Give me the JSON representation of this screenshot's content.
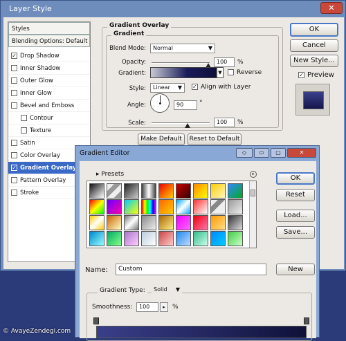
{
  "layer_style": {
    "title": "Layer Style",
    "close_glyph": "✕",
    "list": [
      {
        "label": "Styles",
        "type": "header"
      },
      {
        "label": "Blending Options: Default",
        "type": "header"
      },
      {
        "label": "Drop Shadow",
        "checked": true
      },
      {
        "label": "Inner Shadow",
        "checked": false
      },
      {
        "label": "Outer Glow",
        "checked": false
      },
      {
        "label": "Inner Glow",
        "checked": false
      },
      {
        "label": "Bevel and Emboss",
        "checked": false
      },
      {
        "label": "Contour",
        "checked": false,
        "indent": true
      },
      {
        "label": "Texture",
        "checked": false,
        "indent": true
      },
      {
        "label": "Satin",
        "checked": false
      },
      {
        "label": "Color Overlay",
        "checked": false
      },
      {
        "label": "Gradient Overlay",
        "checked": true,
        "selected": true
      },
      {
        "label": "Pattern Overlay",
        "checked": false
      },
      {
        "label": "Stroke",
        "checked": false
      }
    ],
    "panel": {
      "group_title": "Gradient Overlay",
      "sub_title": "Gradient",
      "blend_mode_label": "Blend Mode:",
      "blend_mode_value": "Normal",
      "opacity_label": "Opacity:",
      "opacity_value": "100",
      "opacity_unit": "%",
      "gradient_label": "Gradient:",
      "reverse_label": "Reverse",
      "style_label": "Style:",
      "style_value": "Linear",
      "align_label": "Align with Layer",
      "angle_label": "Angle:",
      "angle_value": "90",
      "angle_unit": "°",
      "scale_label": "Scale:",
      "scale_value": "100",
      "scale_unit": "%",
      "make_default": "Make Default",
      "reset_default": "Reset to Default"
    },
    "buttons": {
      "ok": "OK",
      "cancel": "Cancel",
      "new_style": "New Style...",
      "preview": "Preview"
    },
    "preview_checked": true
  },
  "gradient_editor": {
    "title": "Gradient Editor",
    "presets_label": "Presets",
    "name_label": "Name:",
    "name_value": "Custom",
    "new_button": "New",
    "buttons": {
      "ok": "OK",
      "reset": "Reset",
      "load": "Load...",
      "save": "Save..."
    },
    "gradient_type_label": "Gradient Type:",
    "gradient_type_value": "Solid",
    "smoothness_label": "Smoothness:",
    "smoothness_value": "100",
    "smoothness_unit": "%"
  },
  "watermark": "© AvayeZendegi.com",
  "colors": {
    "accent": "#3b69c7",
    "title_bar": "#6e8dbd",
    "gradient_dark": "#1a1c5a"
  }
}
